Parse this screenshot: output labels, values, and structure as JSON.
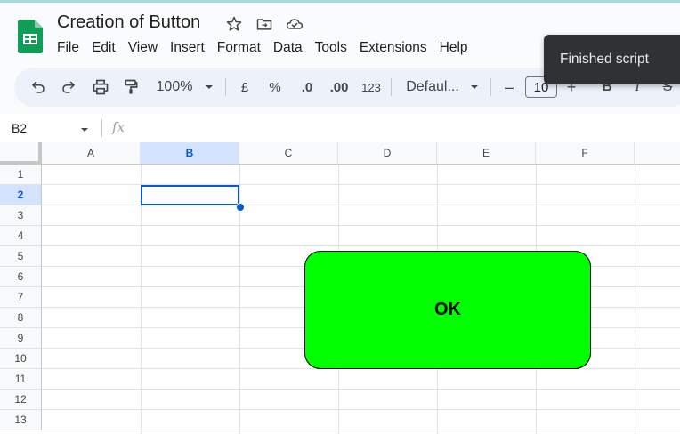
{
  "app": {
    "doc_title": "Creation of Button",
    "menu": [
      "File",
      "Edit",
      "View",
      "Insert",
      "Format",
      "Data",
      "Tools",
      "Extensions",
      "Help"
    ]
  },
  "toolbar": {
    "zoom": "100%",
    "currency": "£",
    "percent": "%",
    "decrease_decimal": ".0",
    "increase_decimal": ".00",
    "number_format": "123",
    "font_name": "Defaul...",
    "font_size": "10",
    "minus": "–",
    "plus": "+",
    "bold": "B",
    "italic": "I",
    "strike": "S"
  },
  "toast": {
    "text": "Finished script"
  },
  "formula_bar": {
    "name_box": "B2",
    "fx": "fx"
  },
  "sheet": {
    "columns": [
      "A",
      "B",
      "C",
      "D",
      "E",
      "F"
    ],
    "rows": [
      "1",
      "2",
      "3",
      "4",
      "5",
      "6",
      "7",
      "8",
      "9",
      "10",
      "11",
      "12",
      "13"
    ],
    "selected_cell": "B2"
  },
  "drawing_button": {
    "label": "OK",
    "fill": "#00ff00"
  },
  "colors": {
    "accent": "#0b57d0",
    "selection_header": "#d3e3fd",
    "sheets_green": "#0f9d58"
  }
}
